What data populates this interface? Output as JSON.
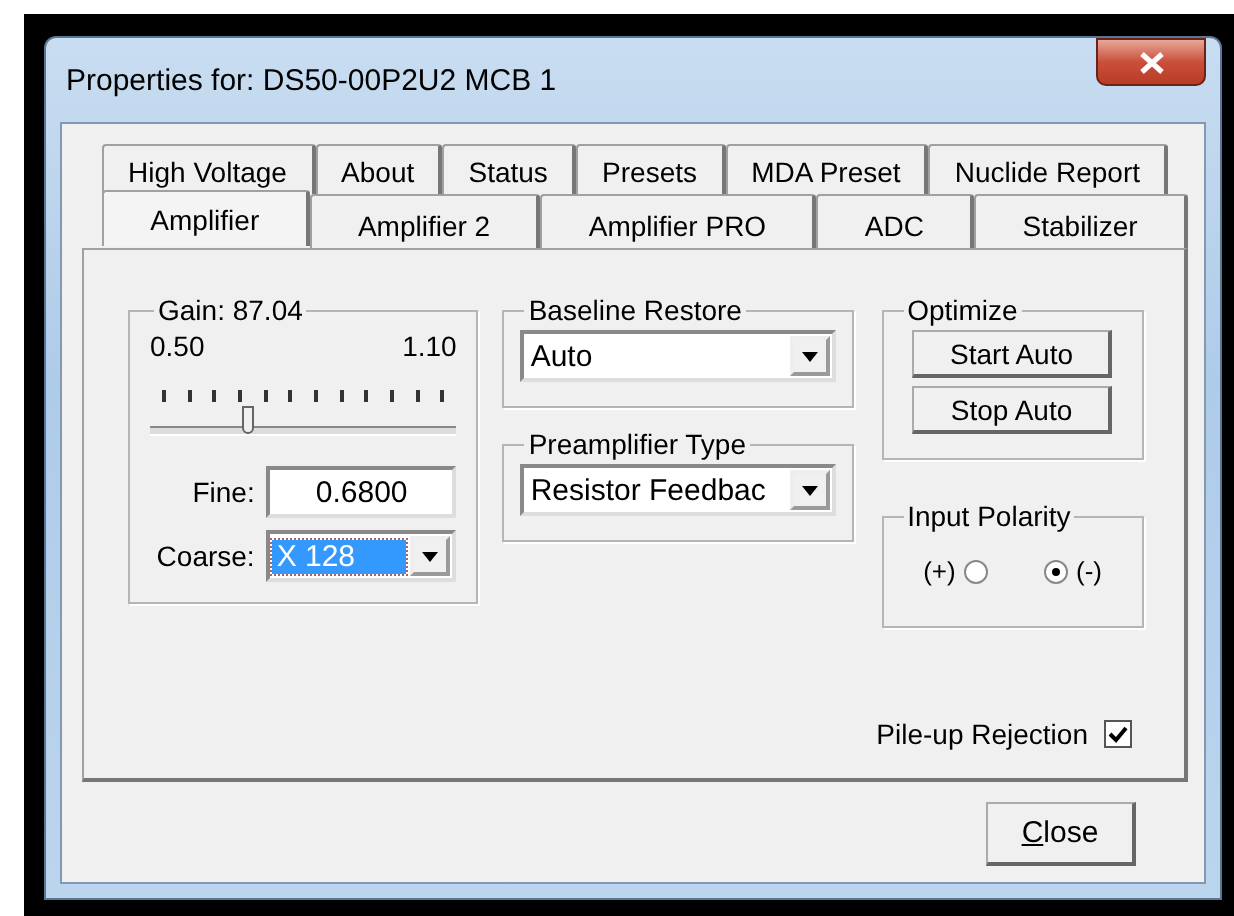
{
  "window": {
    "title": "Properties for: DS50-00P2U2 MCB 1"
  },
  "tab_rows": [
    [
      {
        "label": "High Voltage",
        "selected": false
      },
      {
        "label": "About",
        "selected": false
      },
      {
        "label": "Status",
        "selected": false
      },
      {
        "label": "Presets",
        "selected": false
      },
      {
        "label": "MDA Preset",
        "selected": false
      },
      {
        "label": "Nuclide Report",
        "selected": false
      }
    ],
    [
      {
        "label": "Amplifier",
        "selected": true
      },
      {
        "label": "Amplifier 2",
        "selected": false
      },
      {
        "label": "Amplifier PRO",
        "selected": false
      },
      {
        "label": "ADC",
        "selected": false
      },
      {
        "label": "Stabilizer",
        "selected": false
      }
    ]
  ],
  "gain": {
    "title": "Gain: 87.04",
    "min_label": "0.50",
    "max_label": "1.10",
    "level": 0.32,
    "fine_label": "Fine:",
    "fine_value": "0.6800",
    "coarse_label": "Coarse:",
    "coarse_value": "X 128",
    "coarse_highlighted": true
  },
  "baseline_restore": {
    "title": "Baseline Restore",
    "value": "Auto"
  },
  "preamplifier_type": {
    "title": "Preamplifier Type",
    "value": "Resistor Feedbac"
  },
  "optimize": {
    "title": "Optimize",
    "buttons": [
      "Start Auto",
      "Stop Auto"
    ]
  },
  "input_polarity": {
    "title": "Input Polarity",
    "options": [
      {
        "label": "(+)",
        "selected": false
      },
      {
        "label": "(-)",
        "selected": true
      }
    ]
  },
  "pileup_rejection": {
    "label": "Pile-up Rejection",
    "checked": true
  },
  "buttons": [
    {
      "label": "Close"
    }
  ]
}
